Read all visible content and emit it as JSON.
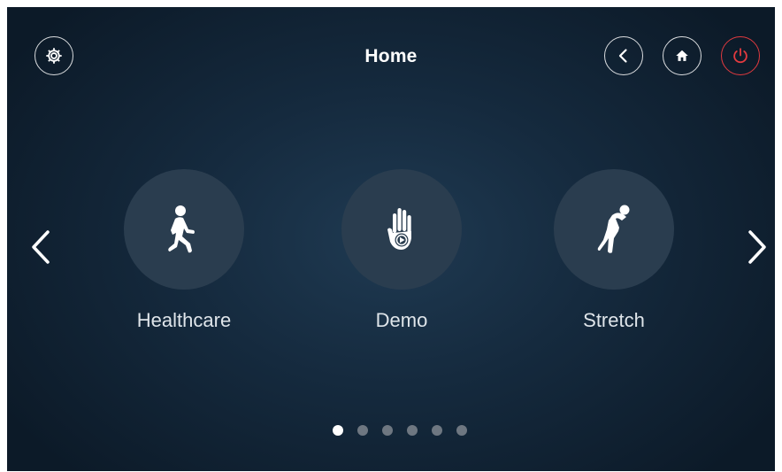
{
  "header": {
    "title": "Home",
    "buttons": [
      {
        "id": "settings",
        "icon": "gear-icon"
      },
      {
        "id": "back",
        "icon": "chevron-left-icon"
      },
      {
        "id": "home",
        "icon": "home-icon"
      },
      {
        "id": "power",
        "icon": "power-icon",
        "color": "#e23a3f"
      }
    ]
  },
  "carousel": {
    "items": [
      {
        "label": "Healthcare",
        "icon": "walking-person-icon"
      },
      {
        "label": "Demo",
        "icon": "hand-play-icon"
      },
      {
        "label": "Stretch",
        "icon": "stretching-person-icon"
      }
    ],
    "prev_icon": "chevron-left-icon",
    "next_icon": "chevron-right-icon"
  },
  "pagination": {
    "total": 6,
    "current": 1
  },
  "colors": {
    "accent_power": "#e23a3f",
    "tile_bg": "#2a3d4f",
    "background": "#152a3e"
  }
}
